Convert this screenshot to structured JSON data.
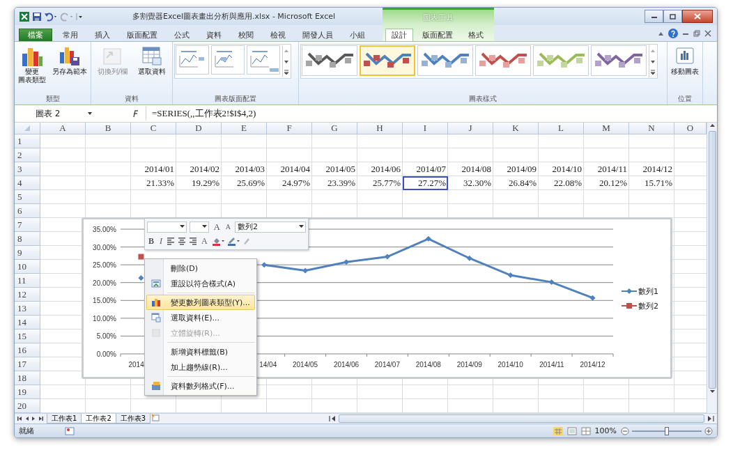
{
  "window": {
    "title": "多割覺器Excel圖表畫出分析與應用.xlsx - Microsoft Excel",
    "contextual_group": "圖表工具"
  },
  "tabs": [
    {
      "label": "檔案",
      "kind": "file",
      "selected": false
    },
    {
      "label": "常用",
      "kind": "normal",
      "selected": false
    },
    {
      "label": "插入",
      "kind": "normal",
      "selected": false
    },
    {
      "label": "版面配置",
      "kind": "normal",
      "selected": false
    },
    {
      "label": "公式",
      "kind": "normal",
      "selected": false
    },
    {
      "label": "資料",
      "kind": "normal",
      "selected": false
    },
    {
      "label": "校閱",
      "kind": "normal",
      "selected": false
    },
    {
      "label": "檢視",
      "kind": "normal",
      "selected": false
    },
    {
      "label": "開發人員",
      "kind": "normal",
      "selected": false
    },
    {
      "label": "小組",
      "kind": "normal",
      "selected": false
    },
    {
      "label": "設計",
      "kind": "contextual",
      "selected": true
    },
    {
      "label": "版面配置",
      "kind": "contextual",
      "selected": false
    },
    {
      "label": "格式",
      "kind": "contextual",
      "selected": false
    }
  ],
  "ribbon": {
    "groups": [
      {
        "label": "類型",
        "kind": "buttons",
        "items": [
          {
            "lines": [
              "變更",
              "圖表類型"
            ],
            "disabled": false
          },
          {
            "lines": [
              "另存為範本"
            ],
            "disabled": false
          }
        ]
      },
      {
        "label": "資料",
        "kind": "buttons",
        "items": [
          {
            "lines": [
              "切換列/欄"
            ],
            "disabled": true
          },
          {
            "lines": [
              "選取資料"
            ],
            "disabled": false
          }
        ]
      },
      {
        "label": "圖表版面配置",
        "kind": "layouts",
        "items": [
          {
            "selected": false
          },
          {
            "selected": false
          },
          {
            "selected": false
          }
        ]
      },
      {
        "label": "圖表樣式",
        "kind": "styles",
        "items": [
          {
            "line": {
              "color": "#595959"
            },
            "markers": {
              "color": "#a6a6a6"
            },
            "selected": false
          },
          {
            "line": {
              "color": "#4f81bd"
            },
            "markers": {
              "color": "#c0504d"
            },
            "selected": true
          },
          {
            "line": {
              "color": "#4f81bd"
            },
            "markers": {
              "color": "#95b3d7"
            },
            "selected": false
          },
          {
            "line": {
              "color": "#c0504d"
            },
            "markers": {
              "color": "#e6a09e"
            },
            "selected": false
          },
          {
            "line": {
              "color": "#9bbb59"
            },
            "markers": {
              "color": "#c3d69b"
            },
            "selected": false
          },
          {
            "line": {
              "color": "#8064a2"
            },
            "markers": {
              "color": "#b3a2c7"
            },
            "selected": false
          }
        ]
      },
      {
        "label": "位置",
        "kind": "buttons",
        "items": [
          {
            "lines": [
              "移動圖表"
            ],
            "disabled": false
          }
        ]
      }
    ]
  },
  "formula_bar": {
    "name_box": "圖表 2",
    "formula": "=SERIES(,,工作表2!$I$4,2)"
  },
  "sheet": {
    "columns": [
      "A",
      "B",
      "C",
      "D",
      "E",
      "F",
      "G",
      "H",
      "I",
      "J",
      "K",
      "L",
      "M",
      "N",
      "O"
    ],
    "rows": [
      {
        "header": "1"
      },
      {
        "header": "2"
      },
      {
        "header": "3",
        "cells": [
          null,
          null,
          {
            "text": "2014/01",
            "selected": false
          },
          {
            "text": "2014/02",
            "selected": false
          },
          {
            "text": "2014/03",
            "selected": false
          },
          {
            "text": "2014/04",
            "selected": false
          },
          {
            "text": "2014/05",
            "selected": false
          },
          {
            "text": "2014/06",
            "selected": false
          },
          {
            "text": "2014/07",
            "selected": false
          },
          {
            "text": "2014/08",
            "selected": false
          },
          {
            "text": "2014/09",
            "selected": false
          },
          {
            "text": "2014/10",
            "selected": false
          },
          {
            "text": "2014/11",
            "selected": false
          },
          {
            "text": "2014/12",
            "selected": false
          },
          null
        ]
      },
      {
        "header": "4",
        "cells": [
          null,
          null,
          {
            "text": "21.33%",
            "selected": false
          },
          {
            "text": "19.29%",
            "selected": false
          },
          {
            "text": "25.69%",
            "selected": false
          },
          {
            "text": "24.97%",
            "selected": false
          },
          {
            "text": "23.39%",
            "selected": false
          },
          {
            "text": "25.77%",
            "selected": false
          },
          {
            "text": "27.27%",
            "selected": true
          },
          {
            "text": "32.30%",
            "selected": false
          },
          {
            "text": "26.84%",
            "selected": false
          },
          {
            "text": "22.08%",
            "selected": false
          },
          {
            "text": "20.12%",
            "selected": false
          },
          {
            "text": "15.71%",
            "selected": false
          },
          null
        ]
      },
      {
        "header": "5"
      },
      {
        "header": "6"
      },
      {
        "header": "7"
      },
      {
        "header": "8"
      },
      {
        "header": "9"
      },
      {
        "header": "10"
      },
      {
        "header": "11"
      },
      {
        "header": "12"
      },
      {
        "header": "13"
      },
      {
        "header": "14"
      },
      {
        "header": "15"
      },
      {
        "header": "16"
      },
      {
        "header": "17"
      },
      {
        "header": "18"
      },
      {
        "header": "19"
      },
      {
        "header": "20"
      }
    ]
  },
  "chart": {
    "chart_data": {
      "type": "line",
      "categories": [
        "2014",
        null,
        null,
        "14/04",
        "2014/05",
        "2014/06",
        "2014/07",
        "2014/08",
        "2014/09",
        "2014/10",
        "2014/11",
        "2014/12"
      ],
      "ylim": [
        0,
        35
      ],
      "yticks": [
        {
          "value": 0,
          "label": "0.00%"
        },
        {
          "value": 5,
          "label": "5.00%"
        },
        {
          "value": 10,
          "label": "10.00%"
        },
        {
          "value": 15,
          "label": "15.00%"
        },
        {
          "value": 20,
          "label": "20.00%"
        },
        {
          "value": 25,
          "label": "25.00%"
        },
        {
          "value": 30,
          "label": "30.00%"
        },
        {
          "value": 35,
          "label": "35.00%"
        }
      ],
      "grid": true,
      "legend": true,
      "series": [
        {
          "name": "數列1",
          "color": "#4f81bd",
          "marker": "diamond",
          "values": [
            21.33,
            null,
            null,
            24.97,
            23.39,
            25.77,
            27.27,
            32.3,
            26.84,
            22.08,
            20.12,
            15.71
          ]
        },
        {
          "name": "數列2",
          "color": "#c0504d",
          "marker": "square",
          "values": [
            27.27,
            null,
            null,
            null,
            null,
            null,
            null,
            null,
            null,
            null,
            null,
            null
          ]
        }
      ]
    }
  },
  "mini_toolbar": {
    "grow_font": "A",
    "shrink_font": "A",
    "series_box": "數列2",
    "bold": "B",
    "italic": "I",
    "font_color": "A"
  },
  "context_menu": [
    {
      "kind": "item",
      "label": "刪除(D)",
      "disabled": false,
      "selected": false
    },
    {
      "kind": "item",
      "label": "重設以符合樣式(A)",
      "disabled": false,
      "selected": false
    },
    {
      "kind": "separator"
    },
    {
      "kind": "item",
      "label": "變更數列圖表類型(Y)...",
      "disabled": false,
      "selected": true
    },
    {
      "kind": "item",
      "label": "選取資料(E)...",
      "disabled": false,
      "selected": false
    },
    {
      "kind": "item",
      "label": "立體旋轉(R)...",
      "disabled": true,
      "selected": false
    },
    {
      "kind": "separator"
    },
    {
      "kind": "item",
      "label": "新增資料標籤(B)",
      "disabled": false,
      "selected": false
    },
    {
      "kind": "item",
      "label": "加上趨勢線(R)...",
      "disabled": false,
      "selected": false
    },
    {
      "kind": "separator"
    },
    {
      "kind": "item",
      "label": "資料數列格式(F)...",
      "disabled": false,
      "selected": false
    }
  ],
  "sheet_tabs": [
    {
      "label": "工作表1",
      "selected": false
    },
    {
      "label": "工作表2",
      "selected": true
    },
    {
      "label": "工作表3",
      "selected": false
    }
  ],
  "status_bar": {
    "status": "就緒",
    "zoom": "100%",
    "zoom_slider": {
      "level": 0.5
    }
  }
}
